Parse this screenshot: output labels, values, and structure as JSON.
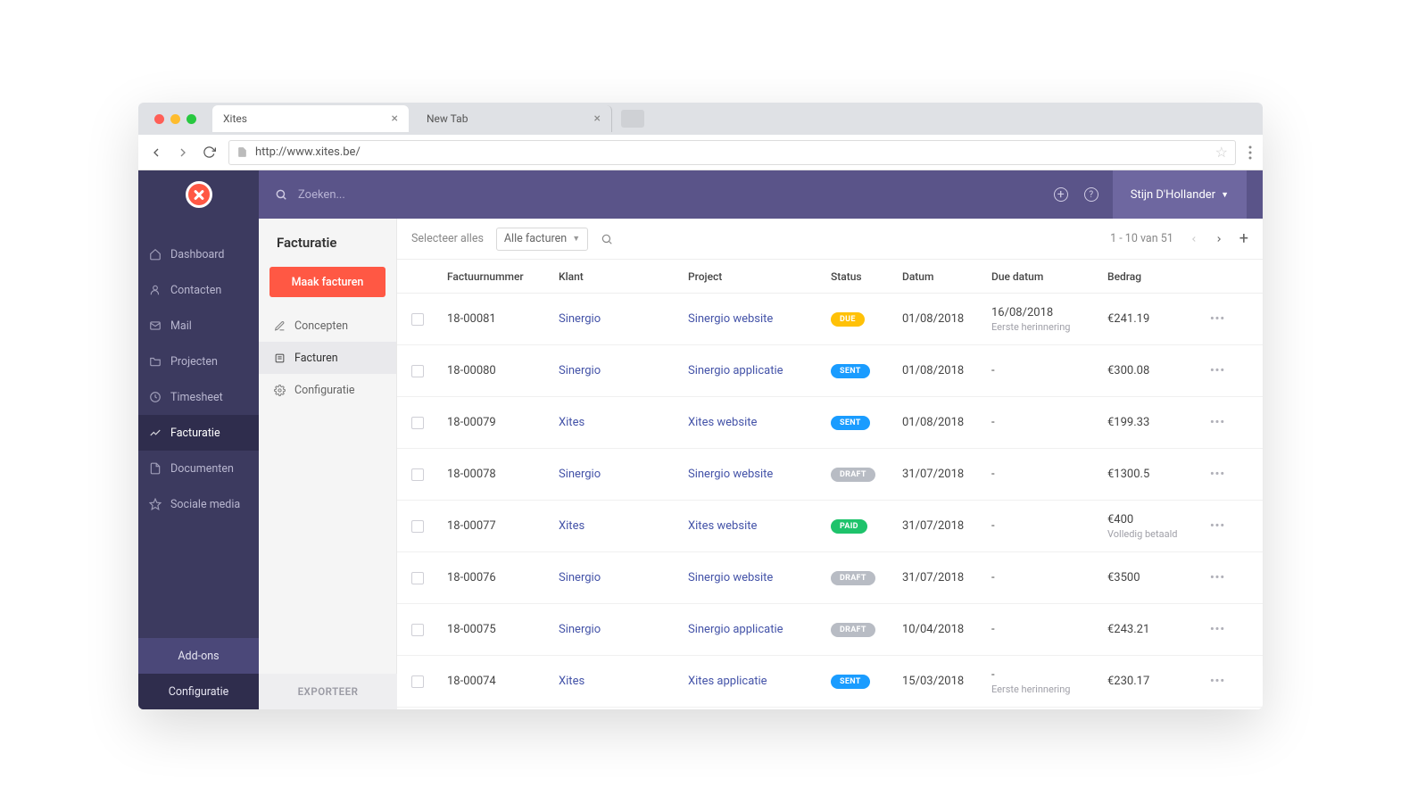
{
  "browser": {
    "tabs": [
      {
        "title": "Xites",
        "active": true
      },
      {
        "title": "New Tab",
        "active": false
      }
    ],
    "url": "http://www.xites.be/"
  },
  "topbar": {
    "search_placeholder": "Zoeken...",
    "user_name": "Stijn D'Hollander"
  },
  "sidebar": {
    "items": [
      {
        "icon": "home",
        "label": "Dashboard"
      },
      {
        "icon": "user",
        "label": "Contacten"
      },
      {
        "icon": "mail",
        "label": "Mail"
      },
      {
        "icon": "folder",
        "label": "Projecten"
      },
      {
        "icon": "clock",
        "label": "Timesheet"
      },
      {
        "icon": "chart",
        "label": "Facturatie",
        "active": true
      },
      {
        "icon": "doc",
        "label": "Documenten"
      },
      {
        "icon": "star",
        "label": "Sociale media"
      }
    ],
    "footer": {
      "addons": "Add-ons",
      "config": "Configuratie"
    }
  },
  "subpanel": {
    "title": "Facturatie",
    "make_button": "Maak facturen",
    "items": [
      {
        "icon": "edit",
        "label": "Concepten"
      },
      {
        "icon": "list",
        "label": "Facturen",
        "active": true
      },
      {
        "icon": "gear",
        "label": "Configuratie"
      }
    ],
    "export": "EXPORTEER"
  },
  "toolbar": {
    "select_all": "Selecteer alles",
    "filter": "Alle facturen",
    "pager": "1 - 10 van 51"
  },
  "table": {
    "headers": {
      "num": "Factuurnummer",
      "klant": "Klant",
      "project": "Project",
      "status": "Status",
      "datum": "Datum",
      "due": "Due datum",
      "bedrag": "Bedrag"
    },
    "rows": [
      {
        "num": "18-00081",
        "klant": "Sinergio",
        "project": "Sinergio website",
        "status": "DUE",
        "datum": "01/08/2018",
        "due": "16/08/2018",
        "due_note": "Eerste herinnering",
        "bedrag": "€241.19"
      },
      {
        "num": "18-00080",
        "klant": "Sinergio",
        "project": "Sinergio applicatie",
        "status": "SENT",
        "datum": "01/08/2018",
        "due": "-",
        "bedrag": "€300.08"
      },
      {
        "num": "18-00079",
        "klant": "Xites",
        "project": "Xites website",
        "status": "SENT",
        "datum": "01/08/2018",
        "due": "-",
        "bedrag": "€199.33"
      },
      {
        "num": "18-00078",
        "klant": "Sinergio",
        "project": "Sinergio website",
        "status": "DRAFT",
        "datum": "31/07/2018",
        "due": "-",
        "bedrag": "€1300.5"
      },
      {
        "num": "18-00077",
        "klant": "Xites",
        "project": "Xites website",
        "status": "PAID",
        "datum": "31/07/2018",
        "due": "-",
        "bedrag": "€400",
        "bedrag_note": "Volledig betaald"
      },
      {
        "num": "18-00076",
        "klant": "Sinergio",
        "project": "Sinergio website",
        "status": "DRAFT",
        "datum": "31/07/2018",
        "due": "-",
        "bedrag": "€3500"
      },
      {
        "num": "18-00075",
        "klant": "Sinergio",
        "project": "Sinergio applicatie",
        "status": "DRAFT",
        "datum": "10/04/2018",
        "due": "-",
        "bedrag": "€243.21"
      },
      {
        "num": "18-00074",
        "klant": "Xites",
        "project": "Xites applicatie",
        "status": "SENT",
        "datum": "15/03/2018",
        "due": "-",
        "due_note": "Eerste herinnering",
        "bedrag": "€230.17"
      }
    ]
  }
}
